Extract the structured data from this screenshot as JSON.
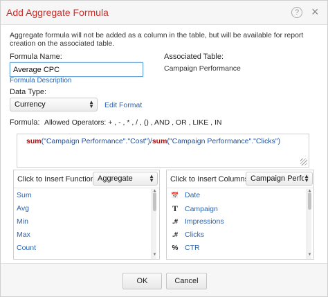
{
  "dialog": {
    "title": "Add Aggregate Formula",
    "help_glyph": "?",
    "close_glyph": "×",
    "info_text": "Aggregate formula will not be added as a column in the table, but will be available for report creation on the associated table."
  },
  "form": {
    "formula_name_label": "Formula Name:",
    "formula_name_value": "Average CPC",
    "formula_description_link": "Formula Description",
    "associated_table_label": "Associated Table:",
    "associated_table_value": "Campaign Performance",
    "data_type_label": "Data Type:",
    "data_type_value": "Currency",
    "edit_format_link": "Edit Format",
    "formula_label": "Formula:",
    "allowed_operators": "Allowed Operators: + , - , * , / , () , AND , OR , LIKE , IN",
    "formula": {
      "fn1": "sum",
      "arg1": "(\"Campaign Performance\".\"Cost\")",
      "op": "/",
      "fn2": "sum",
      "arg2": "(\"Campaign Performance\".\"Clicks\")"
    }
  },
  "functions_panel": {
    "label": "Click to Insert Functions:",
    "selected_category": "Aggregate",
    "items": [
      "Sum",
      "Avg",
      "Min",
      "Max",
      "Count"
    ]
  },
  "columns_panel": {
    "label": "Click to Insert Columns:",
    "selected_table": "Campaign Perfor",
    "items": [
      {
        "icon": "date-icon",
        "glyph": "📅",
        "label": "Date"
      },
      {
        "icon": "text-type-icon",
        "glyph": "T",
        "label": "Campaign"
      },
      {
        "icon": "number-type-icon",
        "glyph": ".#",
        "label": "Impressions"
      },
      {
        "icon": "number-type-icon",
        "glyph": ".#",
        "label": "Clicks"
      },
      {
        "icon": "percent-type-icon",
        "glyph": "%",
        "label": "CTR"
      }
    ]
  },
  "footer": {
    "ok_label": "OK",
    "cancel_label": "Cancel"
  }
}
